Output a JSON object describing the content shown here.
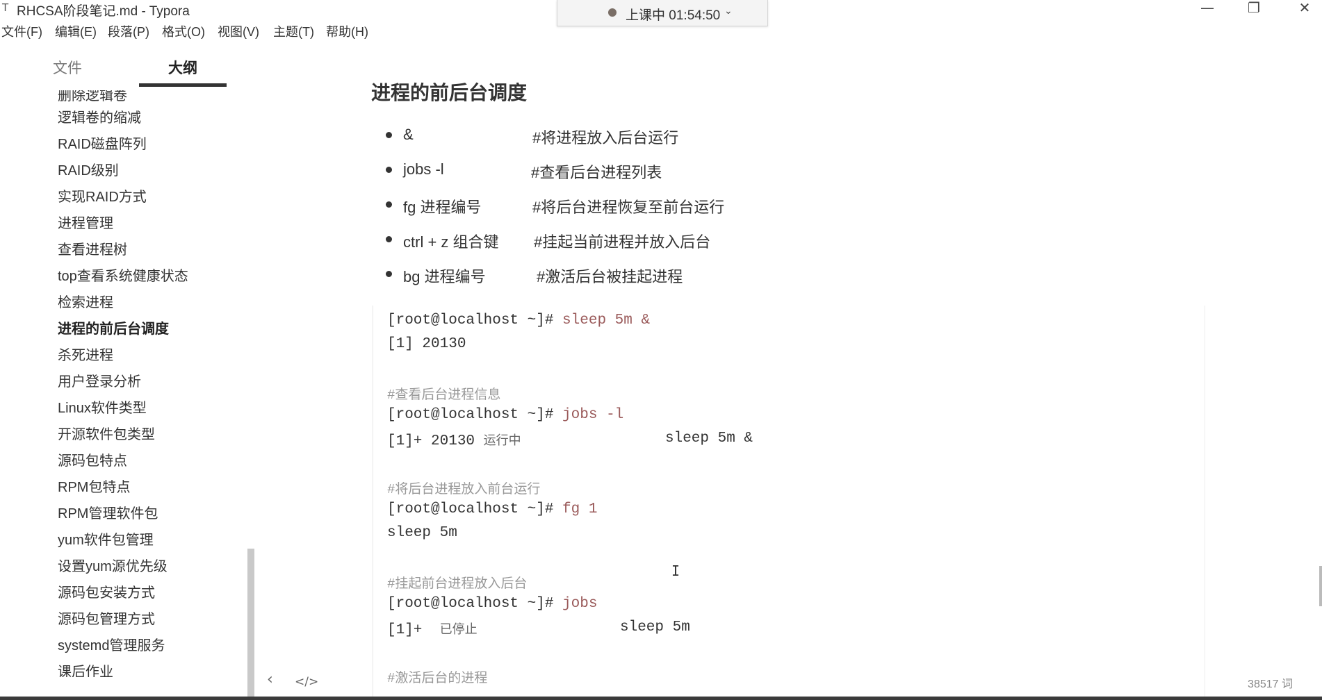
{
  "window": {
    "app_icon": "T",
    "title": "RHCSA阶段笔记.md - Typora",
    "minimize": "—",
    "maximize": "❐",
    "close": "✕"
  },
  "recording": {
    "text": "上课中 01:54:50",
    "chevron": "⌄"
  },
  "menu": [
    "文件(F)",
    "编辑(E)",
    "段落(P)",
    "格式(O)",
    "视图(V)",
    "主题(T)",
    "帮助(H)"
  ],
  "sidebar": {
    "tabs": {
      "files": "文件",
      "outline": "大纲"
    },
    "items": [
      "删除逻辑卷",
      "逻辑卷的缩减",
      "RAID磁盘阵列",
      "RAID级别",
      "实现RAID方式",
      "进程管理",
      "查看进程树",
      "top查看系统健康状态",
      "检索进程",
      "进程的前后台调度",
      "杀死进程",
      "用户登录分析",
      "Linux软件类型",
      "开源软件包类型",
      "源码包特点",
      "RPM包特点",
      "RPM管理软件包",
      "yum软件包管理",
      "设置yum源优先级",
      "源码包安装方式",
      "源码包管理方式",
      "systemd管理服务",
      "课后作业"
    ],
    "active_item": "进程的前后台调度",
    "nav_back": "‹",
    "nav_source": "</>"
  },
  "editor": {
    "heading": "进程的前后台调度",
    "bullets": [
      {
        "cmd": "&",
        "desc": "#将进程放入后台运行"
      },
      {
        "cmd": "jobs -l",
        "desc": "#查看后台进程列表"
      },
      {
        "cmd": "fg 进程编号",
        "desc": "#将后台进程恢复至前台运行"
      },
      {
        "cmd": "ctrl + z 组合键",
        "desc": "#挂起当前进程并放入后台"
      },
      {
        "cmd": "bg 进程编号",
        "desc": "#激活后台被挂起进程"
      }
    ],
    "code": {
      "prompt": "[root@localhost ~]#",
      "l1_cmd": " sleep 5m &",
      "l2": "[1] 20130",
      "c1": "#查看后台进程信息",
      "l3_cmd": " jobs -l",
      "l4_a": "[1]+ 20130 ",
      "l4_state": "运行中",
      "l4_b": "sleep 5m &",
      "c2": "#将后台进程放入前台运行",
      "l5_cmd": " fg 1",
      "l6": "sleep 5m",
      "c3": "#挂起前台进程放入后台",
      "l7_cmd": " jobs",
      "l8_a": "[1]+  ",
      "l8_state": "已停止",
      "l8_b": "sleep 5m",
      "c4": "#激活后台的进程"
    }
  },
  "status": {
    "word_count": "38517 词"
  },
  "cursor": "I"
}
